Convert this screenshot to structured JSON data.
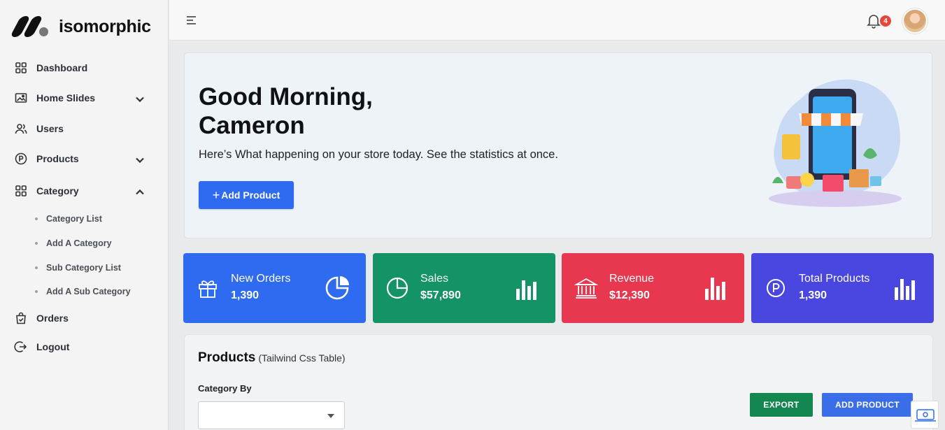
{
  "brand": {
    "name": "isomorphic"
  },
  "sidebar": {
    "items": [
      {
        "label": "Dashboard",
        "icon": "grid-icon"
      },
      {
        "label": "Home Slides",
        "icon": "image-icon",
        "expandable": true,
        "expanded": false
      },
      {
        "label": "Users",
        "icon": "users-icon"
      },
      {
        "label": "Products",
        "icon": "p-circle-icon",
        "expandable": true,
        "expanded": false
      },
      {
        "label": "Category",
        "icon": "grid-icon",
        "expandable": true,
        "expanded": true,
        "children": [
          "Category List",
          "Add A Category",
          "Sub Category List",
          "Add A Sub Category"
        ]
      },
      {
        "label": "Orders",
        "icon": "bag-check-icon"
      },
      {
        "label": "Logout",
        "icon": "logout-icon"
      }
    ]
  },
  "header": {
    "notification_count": "4"
  },
  "hero": {
    "greeting_line1": "Good Morning,",
    "greeting_line2": "Cameron",
    "subtitle": "Here’s What happening on your store today. See the statistics at once.",
    "button_label": "Add Product"
  },
  "stats": [
    {
      "label": "New Orders",
      "value": "1,390",
      "color": "#2f6bf0"
    },
    {
      "label": "Sales",
      "value": "$57,890",
      "color": "#139366"
    },
    {
      "label": "Revenue",
      "value": "$12,390",
      "color": "#e8384f"
    },
    {
      "label": "Total Products",
      "value": "1,390",
      "color": "#4a47e0"
    }
  ],
  "products_panel": {
    "title": "Products",
    "subtitle": "(Tailwind Css Table)",
    "category_label": "Category By",
    "category_value": "",
    "export_label": "EXPORT",
    "add_label": "ADD PRODUCT"
  }
}
